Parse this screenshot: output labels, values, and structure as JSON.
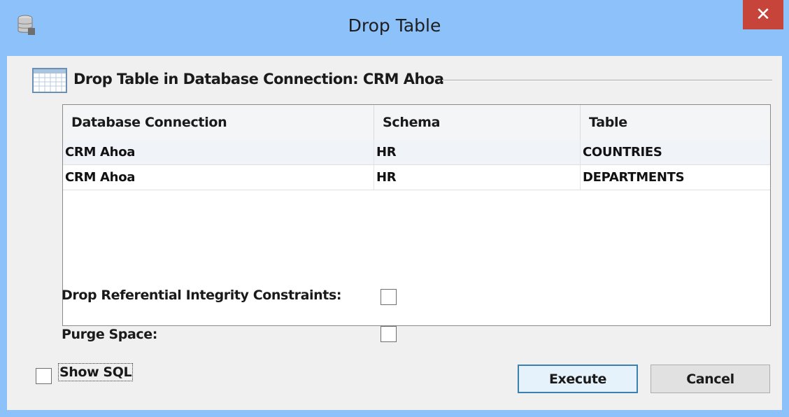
{
  "window": {
    "title": "Drop Table",
    "close_glyph": "✕",
    "app_icon": "database-icon",
    "title_color": "#8dc1f9",
    "close_color": "#c7443b"
  },
  "group": {
    "icon": "table-grid-icon",
    "title": "Drop Table in Database Connection: CRM Ahoa"
  },
  "table": {
    "columns": [
      "Database Connection",
      "Schema",
      "Table"
    ],
    "rows": [
      [
        "CRM Ahoa",
        "HR",
        "COUNTRIES"
      ],
      [
        "CRM Ahoa",
        "HR",
        "DEPARTMENTS"
      ]
    ]
  },
  "options": {
    "drop_constraints_label": "Drop Referential Integrity Constraints:",
    "drop_constraints_checked": false,
    "purge_space_label": "Purge Space:",
    "purge_space_checked": false
  },
  "footer": {
    "show_sql_label": "Show SQL",
    "show_sql_checked": false,
    "execute_label": "Execute",
    "cancel_label": "Cancel"
  }
}
